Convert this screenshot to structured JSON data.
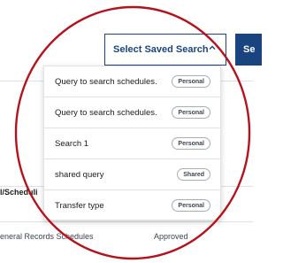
{
  "header": {
    "select_saved_search_label": "Select Saved Search",
    "search_button_label": "Se"
  },
  "saved_search_menu": {
    "items": [
      {
        "label": "Query to search schedules.",
        "badge": "Personal"
      },
      {
        "label": "Query to search schedules.",
        "badge": "Personal"
      },
      {
        "label": "Search 1",
        "badge": "Personal"
      },
      {
        "label": "shared query",
        "badge": "Shared"
      },
      {
        "label": "Transfer type",
        "badge": "Personal"
      }
    ]
  },
  "results_table": {
    "header_partial": "l/Scheduli",
    "row": {
      "col1": "eneral Records Schedules",
      "col2": "Approved"
    }
  },
  "colors": {
    "primary": "#1a4480",
    "annotation": "#b5121b",
    "border": "#dfe1e2"
  }
}
